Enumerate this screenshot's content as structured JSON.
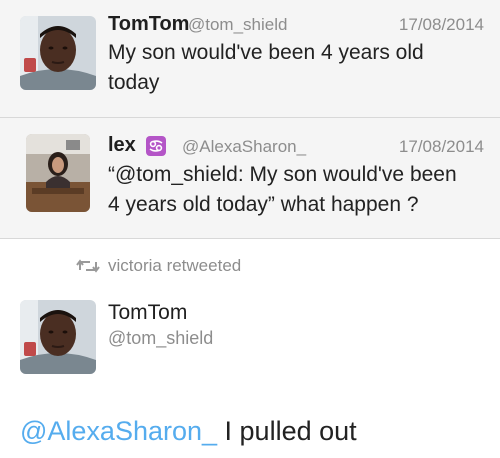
{
  "tweets": [
    {
      "name": "TomTom",
      "handle": "@tom_shield",
      "date": "17/08/2014",
      "text_line1": "My son would've been 4 years old",
      "text_line2": "today"
    },
    {
      "name": "lex",
      "zodiac_icon": "cancer-zodiac-icon",
      "handle": "@AlexaSharon_",
      "date": "17/08/2014",
      "text_line1": "“@tom_shield: My son would've been",
      "text_line2": "4 years old today” what happen ?"
    }
  ],
  "retweet": {
    "icon": "retweet-icon",
    "label": "victoria retweeted"
  },
  "main_tweet": {
    "name": "TomTom",
    "handle": "@tom_shield",
    "mention": "@AlexaSharon_",
    "text": " I pulled out"
  },
  "colors": {
    "mention": "#55acee",
    "secondary_text": "#8d8d8d",
    "zodiac_badge": "#b455c7"
  }
}
